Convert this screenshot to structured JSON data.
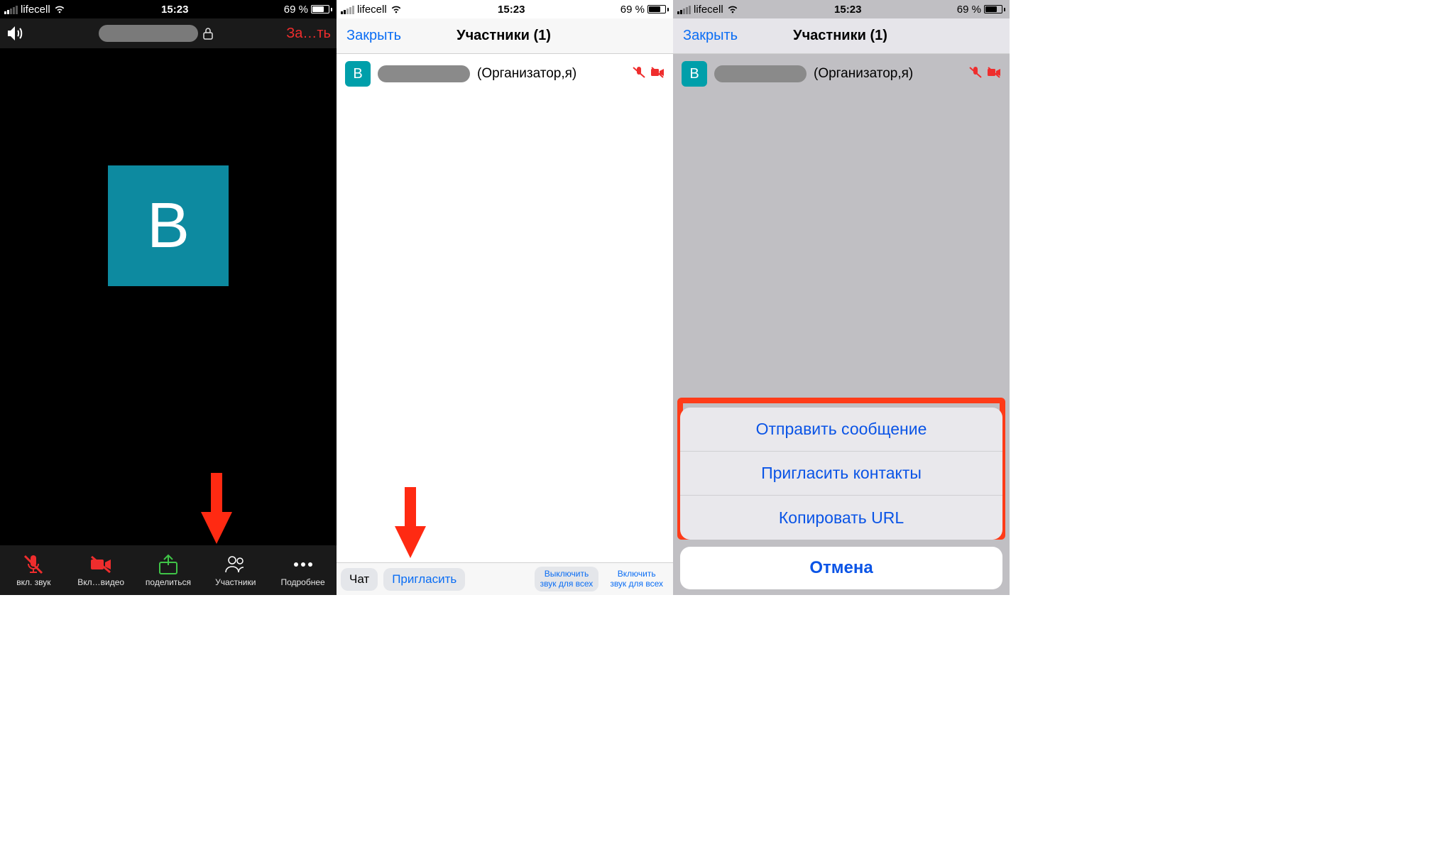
{
  "status": {
    "carrier": "lifecell",
    "time": "15:23",
    "battery_text": "69 %"
  },
  "screen1": {
    "end_label": "За…ть",
    "avatar_letter": "В",
    "toolbar": {
      "audio": "вкл. звук",
      "video": "Вкл…видео",
      "share": "поделиться",
      "participants": "Участники",
      "more": "Подробнее"
    }
  },
  "screen2": {
    "close": "Закрыть",
    "title": "Участники (1)",
    "participant_letter": "В",
    "participant_role": "(Организатор,я)",
    "buttons": {
      "chat": "Чат",
      "invite": "Пригласить",
      "mute_all_l1": "Выключить",
      "mute_all_l2": "звук для всех",
      "unmute_all_l1": "Включить",
      "unmute_all_l2": "звук для всех"
    }
  },
  "screen3": {
    "close": "Закрыть",
    "title": "Участники (1)",
    "participant_letter": "В",
    "participant_role": "(Организатор,я)",
    "sheet": {
      "send_message": "Отправить сообщение",
      "invite_contacts": "Пригласить контакты",
      "copy_url": "Копировать URL",
      "cancel": "Отмена"
    }
  }
}
